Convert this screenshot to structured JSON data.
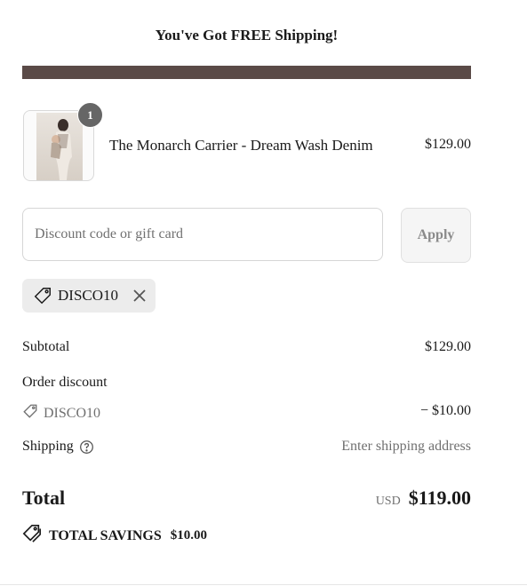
{
  "banner": {
    "text": "You've Got FREE Shipping!",
    "bar_color": "#5a4a47"
  },
  "line_item": {
    "quantity": "1",
    "name": "The Monarch Carrier - Dream Wash Denim",
    "price": "$129.00",
    "image": "product-thumbnail"
  },
  "discount": {
    "placeholder": "Discount code or gift card",
    "value": "",
    "apply_label": "Apply",
    "applied_code": "DISCO10"
  },
  "summary": {
    "subtotal_label": "Subtotal",
    "subtotal_value": "$129.00",
    "order_discount_label": "Order discount",
    "order_discount_code": "DISCO10",
    "order_discount_value": "− $10.00",
    "shipping_label": "Shipping",
    "shipping_value": "Enter shipping address",
    "total_label": "Total",
    "currency": "USD",
    "total_value": "$119.00",
    "savings_label": "TOTAL SAVINGS",
    "savings_value": "$10.00"
  },
  "icons": {
    "tag": "tag-icon",
    "remove": "close-icon",
    "help": "question-circle-icon",
    "savings": "double-tag-icon"
  }
}
